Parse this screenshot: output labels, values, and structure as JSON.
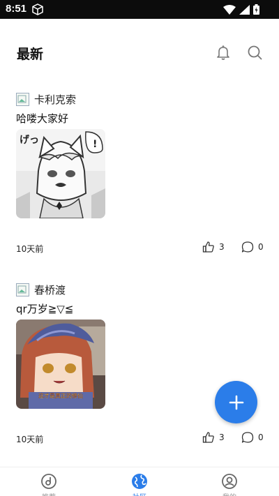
{
  "status_bar": {
    "time": "8:51"
  },
  "header": {
    "title": "最新"
  },
  "posts": [
    {
      "author": "卡利克索",
      "text": "哈喽大家好",
      "time": "10天前",
      "likes": "3",
      "comments": "0",
      "image_caption": "げっ"
    },
    {
      "author": "春桥渡",
      "text": "qr万岁≧▽≦",
      "time": "10天前",
      "likes": "3",
      "comments": "0",
      "image_caption": "这才是真正的修仙"
    }
  ],
  "tabs": [
    {
      "label": "推荐",
      "icon": "disc-icon"
    },
    {
      "label": "社区",
      "icon": "globe-icon",
      "active": true
    },
    {
      "label": "我的",
      "icon": "user-icon"
    }
  ],
  "colors": {
    "accent": "#2b7de9",
    "status_bar": "#0c0c0c"
  }
}
